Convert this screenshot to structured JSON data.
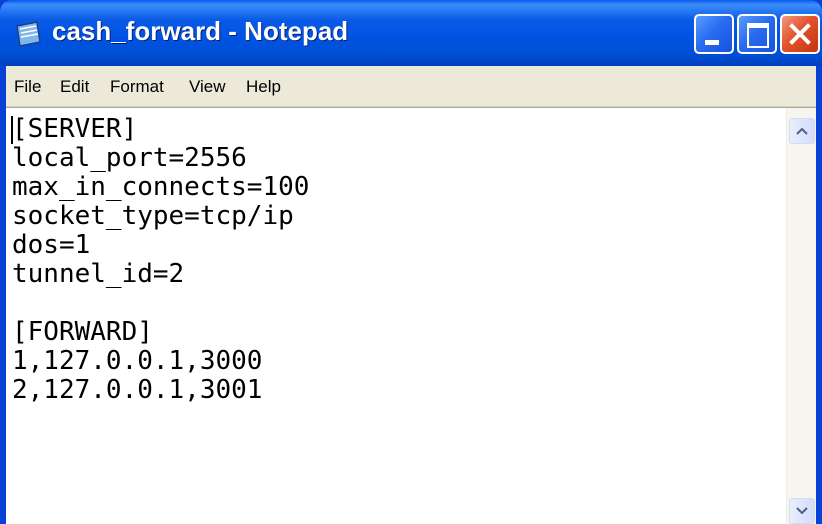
{
  "window": {
    "title": "cash_forward - Notepad",
    "icon": "notepad-icon",
    "controls": [
      "minimize-icon",
      "maximize-icon",
      "close-icon"
    ]
  },
  "menu": [
    "File",
    "Edit",
    "Format",
    "View",
    "Help"
  ],
  "document": {
    "text": "[SERVER]\nlocal_port=2556\nmax_in_connects=100\nsocket_type=tcp/ip\ndos=1\ntunnel_id=2\n\n[FORWARD]\n1,127.0.0.1,3000\n2,127.0.0.1,3001"
  },
  "colors": {
    "titlebar": "#0054e3",
    "close_button": "#e2532d",
    "menubar": "#ece9d8"
  }
}
